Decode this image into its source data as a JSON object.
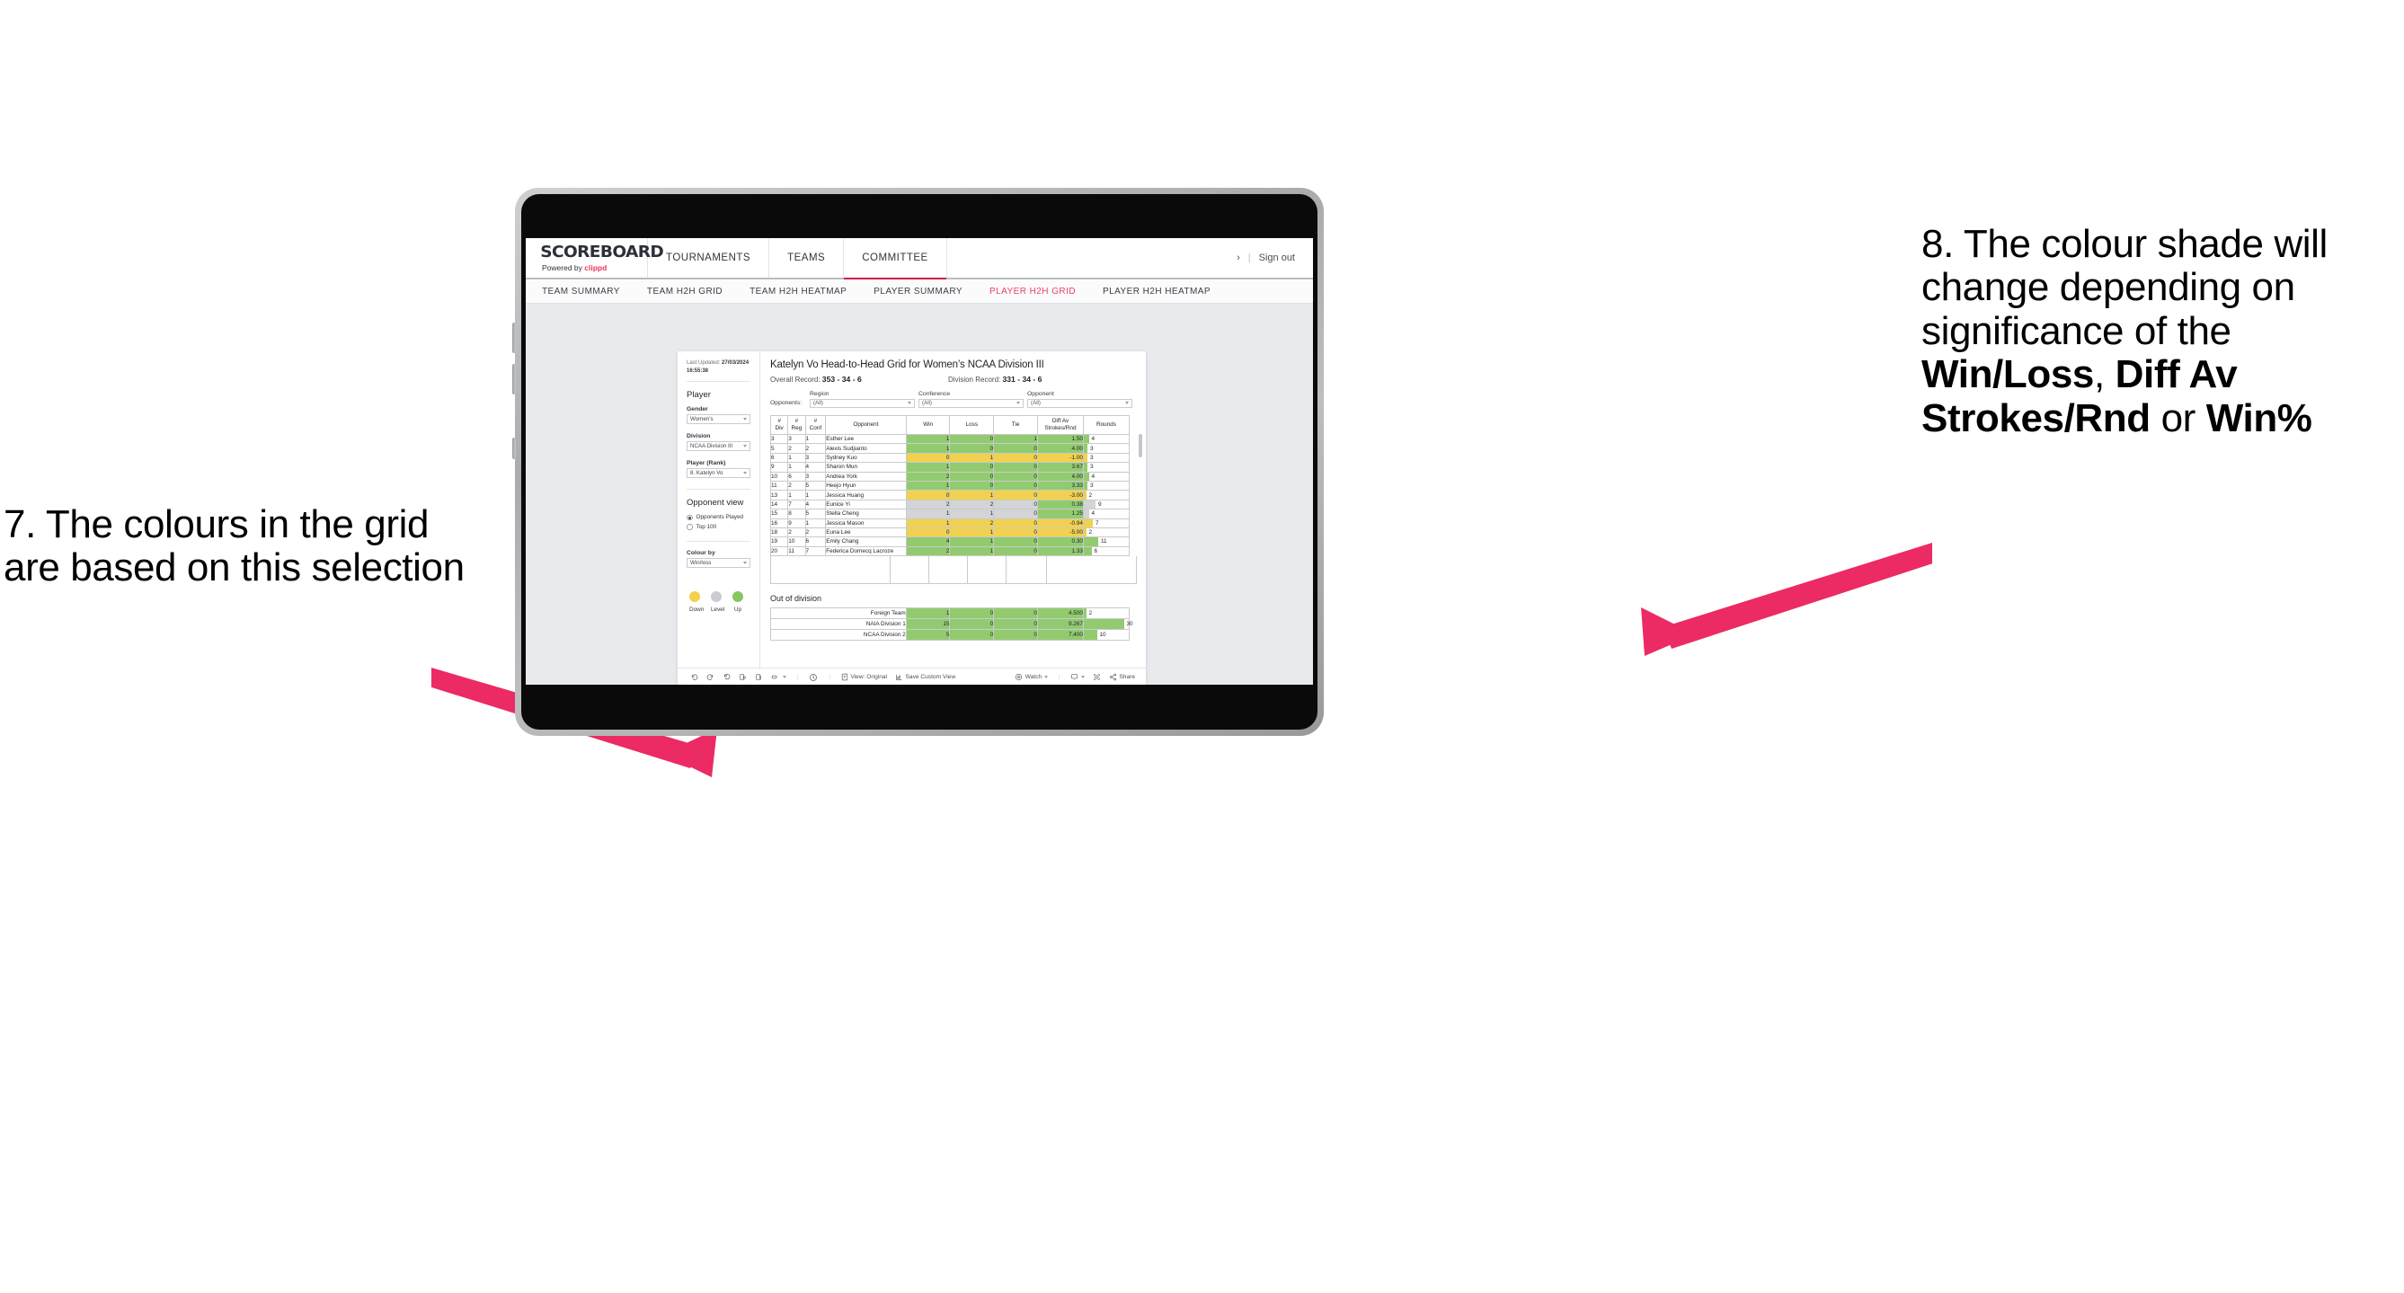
{
  "annotations": {
    "left": "7. The colours in the grid are based on this selection",
    "right_parts": [
      {
        "text": "8. The colour shade will change depending on significance of the ",
        "bold": false
      },
      {
        "text": "Win/Loss",
        "bold": true
      },
      {
        "text": ", ",
        "bold": false
      },
      {
        "text": "Diff Av Strokes/Rnd",
        "bold": true
      },
      {
        "text": " or ",
        "bold": false
      },
      {
        "text": "Win%",
        "bold": true
      }
    ],
    "arrow_color": "#ec2a63"
  },
  "header": {
    "logo_word": "SCOREBOARD",
    "logo_sub_prefix": "Powered by ",
    "logo_brand": "clippd",
    "nav": [
      {
        "label": "TOURNAMENTS",
        "active": false
      },
      {
        "label": "TEAMS",
        "active": false
      },
      {
        "label": "COMMITTEE",
        "active": true
      }
    ],
    "chevron": "›",
    "separator": "|",
    "sign_out": "Sign out"
  },
  "subnav": [
    {
      "label": "TEAM SUMMARY",
      "active": false
    },
    {
      "label": "TEAM H2H GRID",
      "active": false
    },
    {
      "label": "TEAM H2H HEATMAP",
      "active": false
    },
    {
      "label": "PLAYER SUMMARY",
      "active": false
    },
    {
      "label": "PLAYER H2H GRID",
      "active": true
    },
    {
      "label": "PLAYER H2H HEATMAP",
      "active": false
    }
  ],
  "panel": {
    "last_updated_label": "Last Updated: ",
    "last_updated_value": "27/03/2024 16:55:38",
    "heading_player": "Player",
    "fields": [
      {
        "label": "Gender",
        "value": "Women’s"
      },
      {
        "label": "Division",
        "value": "NCAA Division III"
      },
      {
        "label": "Player (Rank)",
        "value": "8. Katelyn Vo"
      }
    ],
    "opponent_view_heading": "Opponent view",
    "opponent_view_options": [
      {
        "label": "Opponents Played",
        "selected": true
      },
      {
        "label": "Top 100",
        "selected": false
      }
    ],
    "colour_by_label": "Colour by",
    "colour_by_value": "Win/loss",
    "legend": [
      {
        "label": "Down",
        "color": "#f1d14e"
      },
      {
        "label": "Level",
        "color": "#c9ccd0"
      },
      {
        "label": "Up",
        "color": "#84c85f"
      }
    ]
  },
  "main": {
    "title": "Katelyn Vo Head-to-Head Grid for Women’s NCAA Division III",
    "overall_record_label": "Overall Record: ",
    "overall_record_value": "353 -  34 - 6",
    "division_record_label": "Division Record: ",
    "division_record_value": "331 -  34 - 6",
    "opponents_label": "Opponents:",
    "opponent_filters": [
      {
        "label": "Region",
        "value": "(All)"
      },
      {
        "label": "Conference",
        "value": "(All)"
      },
      {
        "label": "Opponent",
        "value": "(All)"
      }
    ],
    "out_of_division_title": "Out of division"
  },
  "chart_data": {
    "type": "table",
    "title": "Katelyn Vo Head-to-Head Grid for Women’s NCAA Division III",
    "columns": [
      "# Div",
      "# Reg",
      "# Conf",
      "Opponent",
      "Win",
      "Loss",
      "Tie",
      "Diff Av Strokes/Rnd",
      "Rounds"
    ],
    "column_headers_lines": [
      [
        "#",
        "Div"
      ],
      [
        "#",
        "Reg"
      ],
      [
        "#",
        "Conf"
      ],
      [
        "Opponent"
      ],
      [
        "Win"
      ],
      [
        "Loss"
      ],
      [
        "Tie"
      ],
      [
        "Diff Av",
        "Strokes/Rnd"
      ],
      [
        "Rounds"
      ]
    ],
    "rounds_max": 30,
    "colors": {
      "up": "#92cb6f",
      "down": "#f1d14e",
      "level": "#d2d4d6"
    },
    "rows": [
      {
        "div": "3",
        "reg": "3",
        "conf": "1",
        "opponent": "Esther Lee",
        "win": "1",
        "loss": "0",
        "tie": "1",
        "diff": "1.50",
        "rounds": 4,
        "shade": "up",
        "rounds_shade": "up"
      },
      {
        "div": "5",
        "reg": "2",
        "conf": "2",
        "opponent": "Alexis Sudjianto",
        "win": "1",
        "loss": "0",
        "tie": "0",
        "diff": "4.00",
        "rounds": 3,
        "shade": "up",
        "rounds_shade": "up"
      },
      {
        "div": "6",
        "reg": "1",
        "conf": "3",
        "opponent": "Sydney Kuo",
        "win": "0",
        "loss": "1",
        "tie": "0",
        "diff": "-1.00",
        "rounds": 3,
        "shade": "down",
        "rounds_shade": "down"
      },
      {
        "div": "9",
        "reg": "1",
        "conf": "4",
        "opponent": "Sharon Mun",
        "win": "1",
        "loss": "0",
        "tie": "0",
        "diff": "3.67",
        "rounds": 3,
        "shade": "up",
        "rounds_shade": "up"
      },
      {
        "div": "10",
        "reg": "6",
        "conf": "3",
        "opponent": "Andrea York",
        "win": "2",
        "loss": "0",
        "tie": "0",
        "diff": "4.00",
        "rounds": 4,
        "shade": "up",
        "rounds_shade": "up"
      },
      {
        "div": "11",
        "reg": "2",
        "conf": "5",
        "opponent": "Heejo Hyun",
        "win": "1",
        "loss": "0",
        "tie": "0",
        "diff": "3.33",
        "rounds": 3,
        "shade": "up",
        "rounds_shade": "up"
      },
      {
        "div": "13",
        "reg": "1",
        "conf": "1",
        "opponent": "Jessica Huang",
        "win": "0",
        "loss": "1",
        "tie": "0",
        "diff": "-3.00",
        "rounds": 2,
        "shade": "down",
        "rounds_shade": "down"
      },
      {
        "div": "14",
        "reg": "7",
        "conf": "4",
        "opponent": "Eunice Yi",
        "win": "2",
        "loss": "2",
        "tie": "0",
        "diff": "0.38",
        "rounds": 9,
        "shade": "level",
        "diff_shade": "up",
        "rounds_shade": "level"
      },
      {
        "div": "15",
        "reg": "8",
        "conf": "5",
        "opponent": "Stella Cheng",
        "win": "1",
        "loss": "1",
        "tie": "0",
        "diff": "1.25",
        "rounds": 4,
        "shade": "level",
        "diff_shade": "up",
        "rounds_shade": "level"
      },
      {
        "div": "16",
        "reg": "9",
        "conf": "1",
        "opponent": "Jessica Mason",
        "win": "1",
        "loss": "2",
        "tie": "0",
        "diff": "-0.94",
        "rounds": 7,
        "shade": "down",
        "rounds_shade": "down"
      },
      {
        "div": "18",
        "reg": "2",
        "conf": "2",
        "opponent": "Euna Lee",
        "win": "0",
        "loss": "1",
        "tie": "0",
        "diff": "-5.00",
        "rounds": 2,
        "shade": "down",
        "rounds_shade": "down"
      },
      {
        "div": "19",
        "reg": "10",
        "conf": "6",
        "opponent": "Emily Chang",
        "win": "4",
        "loss": "1",
        "tie": "0",
        "diff": "0.30",
        "rounds": 11,
        "shade": "up",
        "rounds_shade": "up"
      },
      {
        "div": "20",
        "reg": "11",
        "conf": "7",
        "opponent": "Federica Domecq Lacroze",
        "win": "2",
        "loss": "1",
        "tie": "0",
        "diff": "1.33",
        "rounds": 6,
        "shade": "up",
        "rounds_shade": "up"
      }
    ],
    "out_of_division_rows": [
      {
        "name": "Foreign Team",
        "win": "1",
        "loss": "0",
        "tie": "0",
        "diff": "4.500",
        "rounds": 2,
        "shade": "up"
      },
      {
        "name": "NAIA Division 1",
        "win": "15",
        "loss": "0",
        "tie": "0",
        "diff": "9.267",
        "rounds": 30,
        "shade": "up"
      },
      {
        "name": "NCAA Division 2",
        "win": "5",
        "loss": "0",
        "tie": "0",
        "diff": "7.400",
        "rounds": 10,
        "shade": "up"
      }
    ]
  },
  "toolbar": {
    "view_label": "View: Original",
    "save_label": "Save Custom View",
    "watch_label": "Watch",
    "share_label": "Share"
  }
}
